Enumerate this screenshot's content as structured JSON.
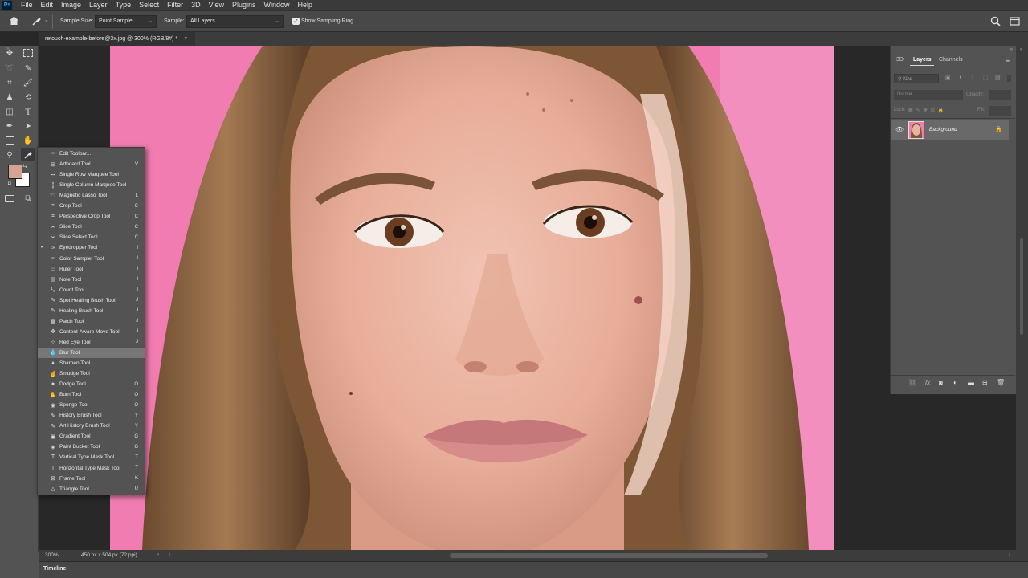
{
  "menubar": {
    "app_logo": "Ps",
    "items": [
      "File",
      "Edit",
      "Image",
      "Layer",
      "Type",
      "Select",
      "Filter",
      "3D",
      "View",
      "Plugins",
      "Window",
      "Help"
    ]
  },
  "options": {
    "sample_size_label": "Sample Size:",
    "sample_size_value": "Point Sample",
    "sample_label": "Sample:",
    "sample_value": "All Layers",
    "sampling_ring_label": "Show Sampling Ring",
    "sampling_ring_checked": true
  },
  "document_tab": {
    "title": "retouch-example-before@3x.jpg @ 300% (RGB/8#) *",
    "close": "×"
  },
  "flyout": {
    "items": [
      {
        "icon": "more-icon",
        "label": "Edit Toolbar...",
        "shortcut": ""
      },
      {
        "icon": "artboard-icon",
        "label": "Artboard Tool",
        "shortcut": "V"
      },
      {
        "icon": "single-row-marquee-icon",
        "label": "Single Row Marquee Tool",
        "shortcut": ""
      },
      {
        "icon": "single-column-marquee-icon",
        "label": "Single Column Marquee Tool",
        "shortcut": ""
      },
      {
        "icon": "magnetic-lasso-icon",
        "label": "Magnetic Lasso Tool",
        "shortcut": "L"
      },
      {
        "icon": "crop-icon",
        "label": "Crop Tool",
        "shortcut": "C"
      },
      {
        "icon": "perspective-crop-icon",
        "label": "Perspective Crop Tool",
        "shortcut": "C"
      },
      {
        "icon": "slice-icon",
        "label": "Slice Tool",
        "shortcut": "C"
      },
      {
        "icon": "slice-select-icon",
        "label": "Slice Select Tool",
        "shortcut": "C"
      },
      {
        "icon": "eyedropper-icon",
        "label": "Eyedropper Tool",
        "shortcut": "I"
      },
      {
        "icon": "color-sampler-icon",
        "label": "Color Sampler Tool",
        "shortcut": "I"
      },
      {
        "icon": "ruler-icon",
        "label": "Ruler Tool",
        "shortcut": "I"
      },
      {
        "icon": "note-icon",
        "label": "Note Tool",
        "shortcut": "I"
      },
      {
        "icon": "count-icon",
        "label": "Count Tool",
        "shortcut": "I"
      },
      {
        "icon": "spot-healing-brush-icon",
        "label": "Spot Healing Brush Tool",
        "shortcut": "J"
      },
      {
        "icon": "healing-brush-icon",
        "label": "Healing Brush Tool",
        "shortcut": "J"
      },
      {
        "icon": "patch-icon",
        "label": "Patch Tool",
        "shortcut": "J"
      },
      {
        "icon": "content-aware-move-icon",
        "label": "Content-Aware Move Tool",
        "shortcut": "J"
      },
      {
        "icon": "red-eye-icon",
        "label": "Red Eye Tool",
        "shortcut": "J"
      },
      {
        "icon": "blur-icon",
        "label": "Blur Tool",
        "shortcut": ""
      },
      {
        "icon": "sharpen-icon",
        "label": "Sharpen Tool",
        "shortcut": ""
      },
      {
        "icon": "smudge-icon",
        "label": "Smudge Tool",
        "shortcut": ""
      },
      {
        "icon": "dodge-icon",
        "label": "Dodge Tool",
        "shortcut": "O"
      },
      {
        "icon": "burn-icon",
        "label": "Burn Tool",
        "shortcut": "O"
      },
      {
        "icon": "sponge-icon",
        "label": "Sponge Tool",
        "shortcut": "O"
      },
      {
        "icon": "history-brush-icon",
        "label": "History Brush Tool",
        "shortcut": "Y"
      },
      {
        "icon": "art-history-brush-icon",
        "label": "Art History Brush Tool",
        "shortcut": "Y"
      },
      {
        "icon": "gradient-icon",
        "label": "Gradient Tool",
        "shortcut": "G"
      },
      {
        "icon": "paint-bucket-icon",
        "label": "Paint Bucket Tool",
        "shortcut": "G"
      },
      {
        "icon": "vertical-type-mask-icon",
        "label": "Vertical Type Mask Tool",
        "shortcut": "T"
      },
      {
        "icon": "horizontal-type-mask-icon",
        "label": "Horizontal Type Mask Tool",
        "shortcut": "T"
      },
      {
        "icon": "frame-icon",
        "label": "Frame Tool",
        "shortcut": "K"
      },
      {
        "icon": "triangle-icon",
        "label": "Triangle Tool",
        "shortcut": "U"
      }
    ],
    "highlighted": "Blur Tool",
    "current": "Eyedropper Tool"
  },
  "panel": {
    "tabs": [
      "3D",
      "Layers",
      "Channels"
    ],
    "active_tab": "Layers",
    "kind_placeholder": "Kind",
    "blend_mode": "Normal",
    "opacity_label": "Opacity:",
    "lock_label": "Lock:",
    "fill_label": "Fill:",
    "layer_name": "Background"
  },
  "status": {
    "zoom": "300%",
    "doc_info": "450 px x 504 px (72 ppi)"
  },
  "timeline": {
    "label": "Timeline"
  },
  "colors": {
    "foreground": "#d4a393",
    "background": "#ffffff",
    "photo_backdrop": "#f07cb1"
  }
}
